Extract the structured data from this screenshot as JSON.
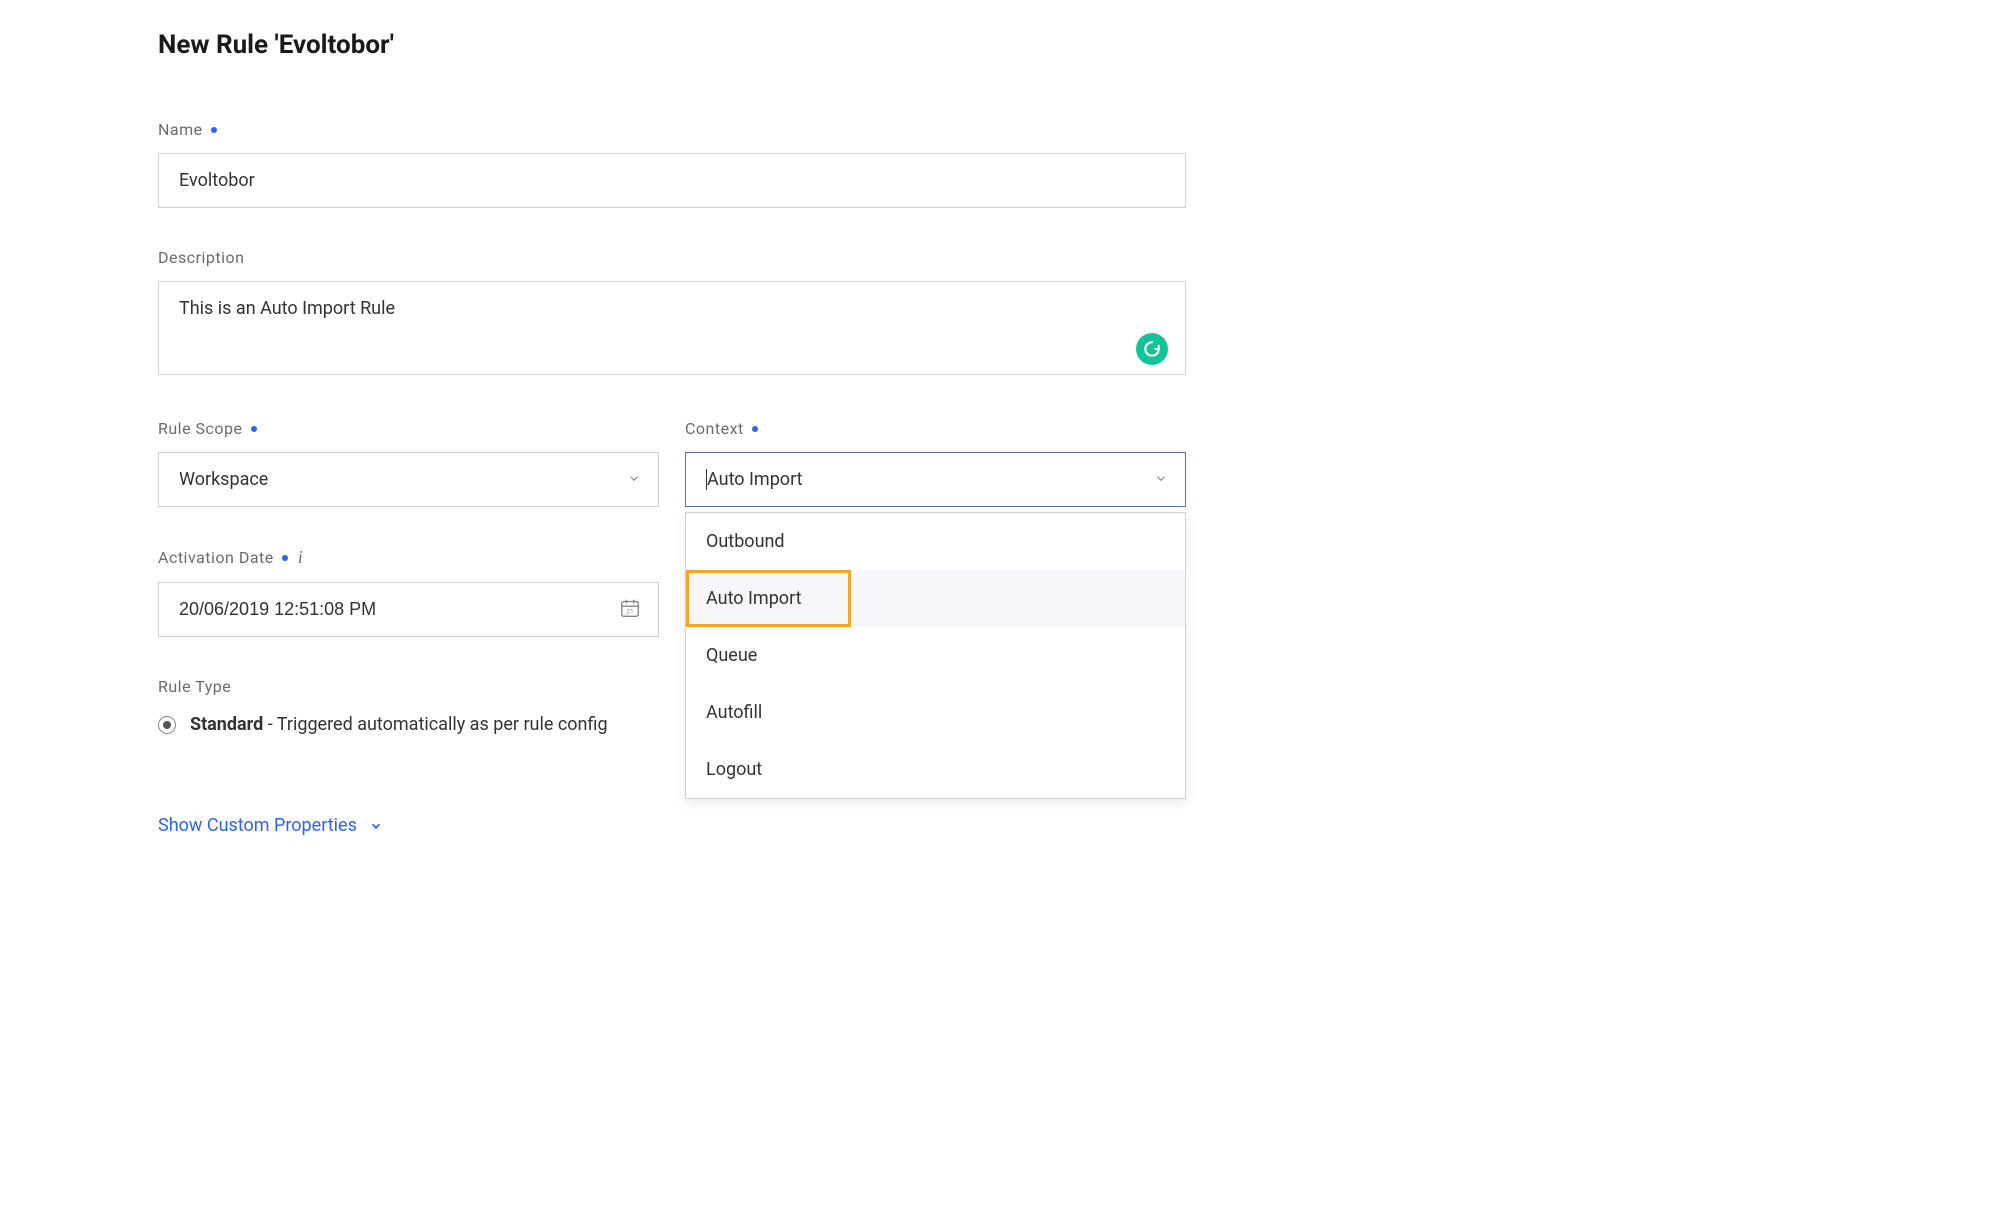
{
  "pageTitle": "New Rule 'Evoltobor'",
  "fields": {
    "name": {
      "label": "Name",
      "value": "Evoltobor"
    },
    "description": {
      "label": "Description",
      "value": "This is an Auto Import Rule"
    },
    "ruleScope": {
      "label": "Rule Scope",
      "value": "Workspace"
    },
    "context": {
      "label": "Context",
      "value": "Auto Import",
      "options": [
        "Outbound",
        "Auto Import",
        "Queue",
        "Autofill",
        "Logout"
      ]
    },
    "activationDate": {
      "label": "Activation Date",
      "value": "20/06/2019 12:51:08 PM"
    },
    "ruleType": {
      "label": "Rule Type",
      "selectedBold": "Standard",
      "selectedRest": " - Triggered automatically as per rule config"
    }
  },
  "links": {
    "showCustom": "Show Custom Properties"
  }
}
